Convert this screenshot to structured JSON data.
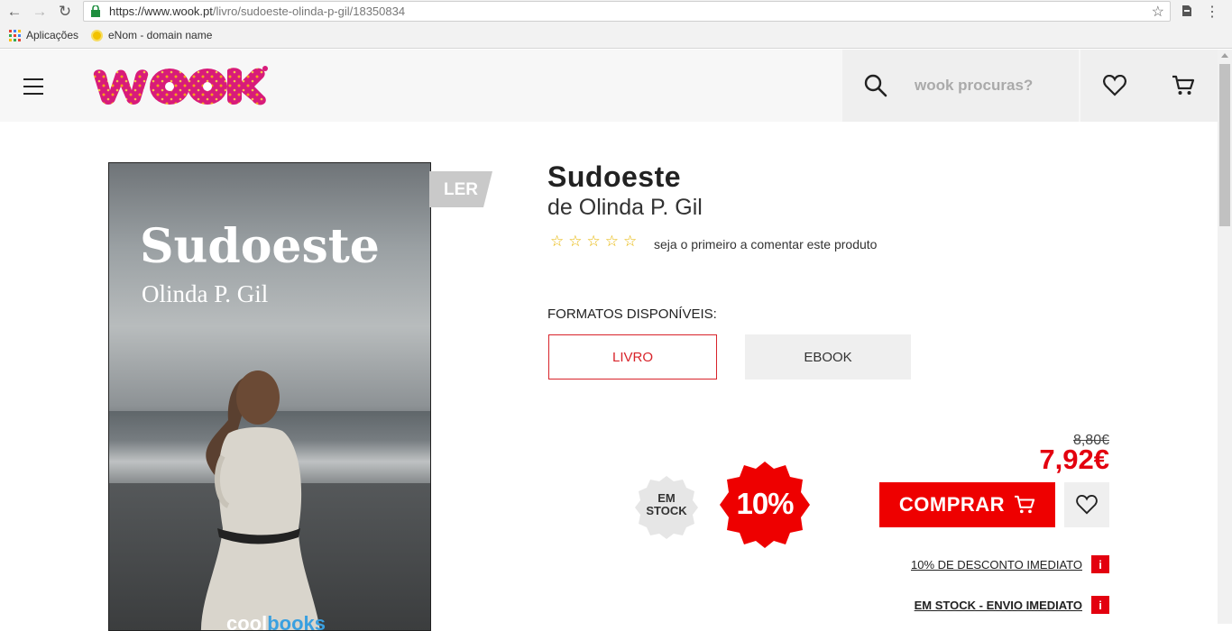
{
  "browser": {
    "url_host": "https://www.wook.pt",
    "url_path": "/livro/sudoeste-olinda-p-gil/18350834",
    "bookmarks": [
      {
        "label": "Aplicações",
        "icon": "apps-grid-icon"
      },
      {
        "label": "eNom - domain name",
        "icon": "enom-icon"
      }
    ]
  },
  "header": {
    "search_placeholder": "wook procuras?",
    "icons": [
      "menu-icon",
      "search-icon",
      "heart-icon",
      "cart-icon"
    ],
    "brand_color": "#e0207a"
  },
  "cover": {
    "title": "Sudoeste",
    "author": "Olinda P. Gil",
    "publisher_a": "cool",
    "publisher_b": "books",
    "ler_label": "LER"
  },
  "product": {
    "title": "Sudoeste",
    "author_line": "de Olinda P. Gil",
    "rating_stars": 0,
    "rating_max": 5,
    "review_link": "seja o primeiro a comentar este produto",
    "formats_label": "FORMATOS DISPONÍVEIS:",
    "formats": [
      "LIVRO",
      "EBOOK"
    ],
    "selected_format": "LIVRO",
    "stock_badge": [
      "EM",
      "STOCK"
    ],
    "discount_badge": "10%",
    "old_price": "8,80€",
    "new_price": "7,92€",
    "buy_label": "COMPRAR",
    "discount_info": "10% DE DESCONTO IMEDIATO",
    "stock_info": "EM STOCK - ENVIO IMEDIATO",
    "info_icon": "i",
    "accent_color": "#e3000f"
  }
}
